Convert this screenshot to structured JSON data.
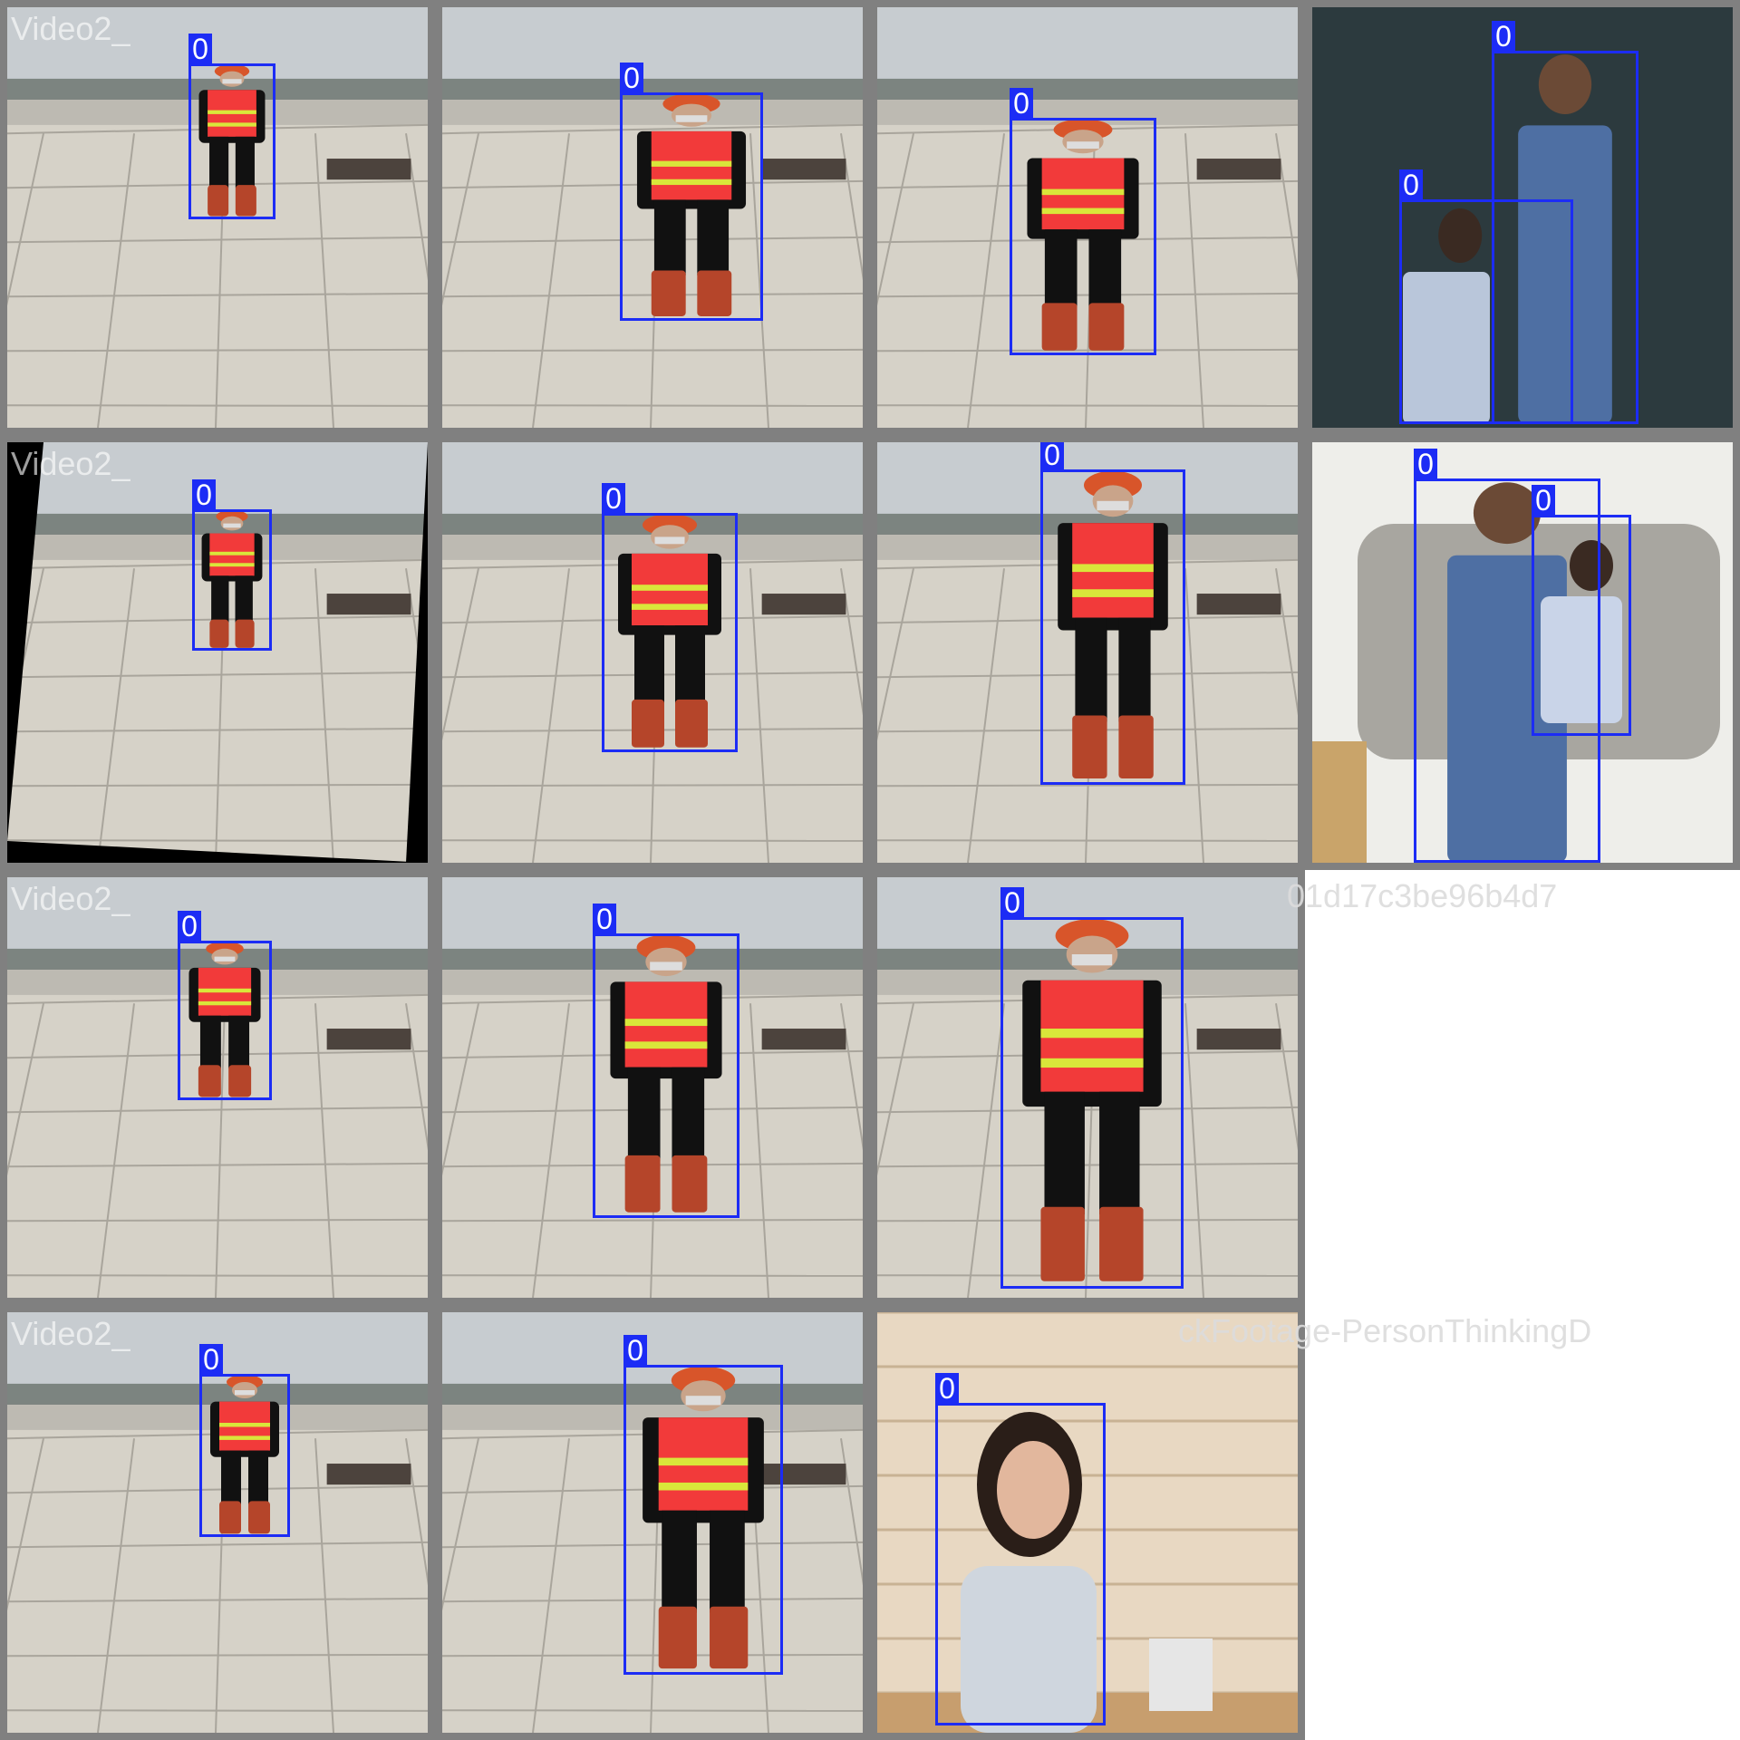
{
  "colors": {
    "tile_border": "#808080",
    "box": "#1c2cf5",
    "label_text": "#ffffff",
    "filename_text": "#ffffff"
  },
  "tiles": [
    {
      "scene": "rooftop",
      "filename": "Video2_",
      "boxes": [
        {
          "label": "0"
        }
      ]
    },
    {
      "scene": "rooftop",
      "filename": "",
      "boxes": [
        {
          "label": "0"
        }
      ]
    },
    {
      "scene": "rooftop",
      "filename": "",
      "boxes": [
        {
          "label": "0"
        }
      ]
    },
    {
      "scene": "dark-wall",
      "filename": "",
      "boxes": [
        {
          "label": "0"
        },
        {
          "label": "0"
        }
      ]
    },
    {
      "scene": "rooftop-rotated",
      "filename": "Video2_",
      "boxes": [
        {
          "label": "0"
        }
      ]
    },
    {
      "scene": "rooftop",
      "filename": "",
      "boxes": [
        {
          "label": "0"
        }
      ]
    },
    {
      "scene": "rooftop-close",
      "filename": "",
      "boxes": [
        {
          "label": "0"
        }
      ]
    },
    {
      "scene": "sofa",
      "filename": "",
      "boxes": [
        {
          "label": "0"
        },
        {
          "label": "0"
        }
      ]
    },
    {
      "scene": "rooftop",
      "filename": "Video2_",
      "boxes": [
        {
          "label": "0"
        }
      ]
    },
    {
      "scene": "rooftop",
      "filename": "",
      "boxes": [
        {
          "label": "0"
        }
      ]
    },
    {
      "scene": "rooftop-close",
      "filename": "",
      "boxes": [
        {
          "label": "0"
        }
      ]
    },
    {
      "scene": "rooftop",
      "filename": "Video2_",
      "boxes": [
        {
          "label": "0"
        }
      ]
    },
    {
      "scene": "rooftop",
      "filename": "",
      "boxes": [
        {
          "label": "0"
        }
      ]
    },
    {
      "scene": "wood-wall",
      "filename": "",
      "boxes": [
        {
          "label": "0"
        }
      ]
    }
  ],
  "overflow_texts": [
    {
      "text": "01d17c3be96b4d7"
    },
    {
      "text": "ckFootage-PersonThinkingD"
    }
  ]
}
